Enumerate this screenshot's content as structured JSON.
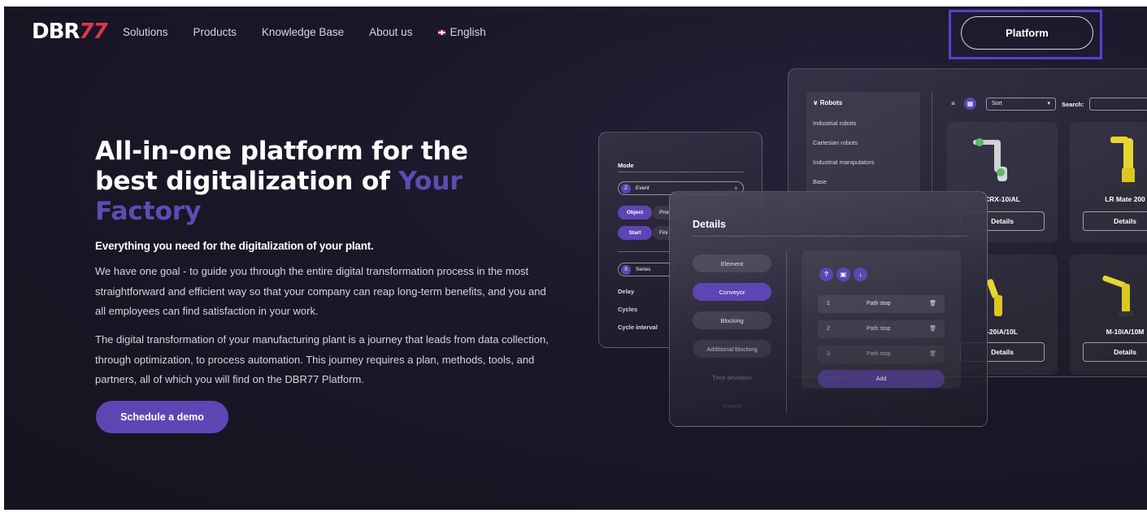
{
  "header": {
    "logo_white": "DBR",
    "logo_red": "77",
    "nav": [
      "Solutions",
      "Products",
      "Knowledge Base",
      "About us"
    ],
    "language": "English",
    "platform_label": "Platform"
  },
  "hero": {
    "title_line1": "All-in-one platform for the",
    "title_line2_start": "best digitalization of ",
    "title_line2_accent": "Your",
    "title_line3_accent": "Factory",
    "subtitle": "Everything you need for the digitalization of your plant.",
    "paragraph1": "We have one goal - to guide you through the entire digital transformation process in the most straightforward and efficient way so that your company can reap long-term benefits, and you and all employees can find satisfaction in your work.",
    "paragraph2": "The digital transformation of your manufacturing plant is a journey that leads from data collection, through optimization, to process automation. This journey requires a plan, methods, tools, and partners, all of which you will find on the DBR77 Platform.",
    "cta": "Schedule a demo"
  },
  "robots_panel": {
    "category": "Robots",
    "items": [
      "Industrial robots",
      "Cartesian robots",
      "Industrial manipulators",
      "Base"
    ],
    "sort_label": "Sort",
    "search_label": "Search:",
    "cards": [
      {
        "name": "CRX-10iAL",
        "button": "Details"
      },
      {
        "name": "LR Mate 200",
        "button": "Details"
      },
      {
        "name": "-20iA/10L",
        "button": "Details"
      },
      {
        "name": "M-10iA/10M",
        "button": "Details"
      }
    ]
  },
  "mode_panel": {
    "title": "Mode",
    "event_badge": "Z",
    "event_label": "Event",
    "object_label": "Object",
    "proc_label": "Proc",
    "start_label": "Start",
    "fini_label": "Fini",
    "series_badge": "S",
    "series_label": "Series",
    "fields": [
      "Delay",
      "Cycles",
      "Cycle interval"
    ]
  },
  "details_panel": {
    "title": "Details",
    "left_items": [
      "Element",
      "Conveyor",
      "Blocking",
      "Additional blocking",
      "Time deviation",
      "Parent"
    ],
    "active_item": "Conveyor",
    "stops": [
      {
        "num": "1",
        "label": "Path stop"
      },
      {
        "num": "2",
        "label": "Path stop"
      },
      {
        "num": "3",
        "label": "Path stop"
      }
    ],
    "add_label": "Add"
  },
  "colors": {
    "accent": "#5d46b4",
    "title_accent": "#5e4bb3",
    "logo_red": "#e0344f",
    "highlight_border": "#5a3fd0",
    "background": "#1a1728"
  }
}
